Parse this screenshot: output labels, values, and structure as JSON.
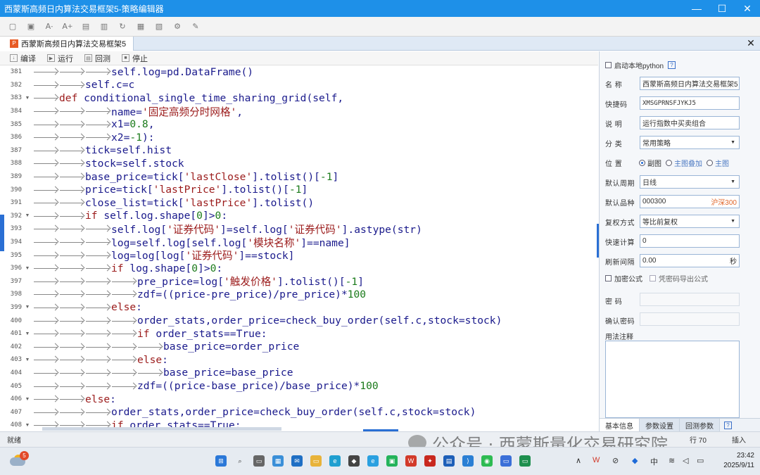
{
  "window": {
    "title": "西蒙斯高频日内算法交易框架5-策略编辑器",
    "controls": [
      "—",
      "☐",
      "✕"
    ]
  },
  "document_tab": {
    "label": "西蒙斯高频日内算法交易框架5",
    "close": "✕"
  },
  "editor_toolbar": [
    {
      "label": "编译",
      "icon": "compile-icon"
    },
    {
      "label": "运行",
      "icon": "run-icon"
    },
    {
      "label": "回测",
      "icon": "backtest-icon"
    },
    {
      "label": "停止",
      "icon": "stop-icon"
    }
  ],
  "code_lines": [
    {
      "n": "381",
      "fold": false,
      "indent": 3,
      "text": "self.log=pd.DataFrame()"
    },
    {
      "n": "382",
      "fold": false,
      "indent": 2,
      "text": "self.c=c"
    },
    {
      "n": "383",
      "fold": true,
      "indent": 1,
      "text": "def conditional_single_time_sharing_grid(self,"
    },
    {
      "n": "384",
      "fold": false,
      "indent": 3,
      "text": "name='固定高频分时网格',"
    },
    {
      "n": "385",
      "fold": false,
      "indent": 3,
      "text": "x1=0.8,"
    },
    {
      "n": "386",
      "fold": false,
      "indent": 3,
      "text": "x2=-1):"
    },
    {
      "n": "387",
      "fold": false,
      "indent": 2,
      "text": "tick=self.hist"
    },
    {
      "n": "388",
      "fold": false,
      "indent": 2,
      "text": "stock=self.stock"
    },
    {
      "n": "389",
      "fold": false,
      "indent": 2,
      "text": "base_price=tick['lastClose'].tolist()[-1]"
    },
    {
      "n": "390",
      "fold": false,
      "indent": 2,
      "text": "price=tick['lastPrice'].tolist()[-1]"
    },
    {
      "n": "391",
      "fold": false,
      "indent": 2,
      "text": "close_list=tick['lastPrice'].tolist()"
    },
    {
      "n": "392",
      "fold": true,
      "indent": 2,
      "text": "if self.log.shape[0]>0:"
    },
    {
      "n": "393",
      "fold": false,
      "indent": 3,
      "text": "self.log['证券代码']=self.log['证券代码'].astype(str)"
    },
    {
      "n": "394",
      "fold": false,
      "indent": 3,
      "text": "log=self.log[self.log['模块名称']==name]"
    },
    {
      "n": "395",
      "fold": false,
      "indent": 3,
      "text": "log=log[log['证券代码']==stock]"
    },
    {
      "n": "396",
      "fold": true,
      "indent": 3,
      "text": "if log.shape[0]>0:"
    },
    {
      "n": "397",
      "fold": false,
      "indent": 4,
      "text": "pre_price=log['触发价格'].tolist()[-1]"
    },
    {
      "n": "398",
      "fold": false,
      "indent": 4,
      "text": "zdf=((price-pre_price)/pre_price)*100"
    },
    {
      "n": "399",
      "fold": true,
      "indent": 3,
      "text": "else:"
    },
    {
      "n": "400",
      "fold": false,
      "indent": 4,
      "text": "order_stats,order_price=check_buy_order(self.c,stock=stock)"
    },
    {
      "n": "401",
      "fold": true,
      "indent": 4,
      "text": "if order_stats==True:"
    },
    {
      "n": "402",
      "fold": false,
      "indent": 5,
      "text": "base_price=order_price"
    },
    {
      "n": "403",
      "fold": true,
      "indent": 4,
      "text": "else:"
    },
    {
      "n": "404",
      "fold": false,
      "indent": 5,
      "text": "base_price=base_price"
    },
    {
      "n": "405",
      "fold": false,
      "indent": 4,
      "text": "zdf=((price-base_price)/base_price)*100"
    },
    {
      "n": "406",
      "fold": true,
      "indent": 2,
      "text": "else:"
    },
    {
      "n": "407",
      "fold": false,
      "indent": 3,
      "text": "order_stats,order_price=check_buy_order(self.c,stock=stock)"
    },
    {
      "n": "408",
      "fold": true,
      "indent": 3,
      "text": "if order_stats==True:"
    }
  ],
  "panel": {
    "local_python_label": "启动本地python",
    "help": "?",
    "name_label": "名 称",
    "name_value": "西蒙斯高频日内算法交易框架5",
    "shortcode_label": "快捷码",
    "shortcode_value": "XMSGPRNSFJYKJ5",
    "desc_label": "说 明",
    "desc_value": "运行指数中买卖组合",
    "category_label": "分 类",
    "category_value": "常用策略",
    "position_label": "位 置",
    "position_options": [
      "副图",
      "主图叠加",
      "主图"
    ],
    "period_label": "默认周期",
    "period_value": "日线",
    "variety_label": "默认品种",
    "variety_value": "000300",
    "variety_market": "沪深300",
    "adjust_label": "复权方式",
    "adjust_value": "等比前复权",
    "quickcalc_label": "快速计算",
    "quickcalc_value": "0",
    "refresh_label": "刷新间隔",
    "refresh_value": "0.00",
    "refresh_unit": "秒",
    "encrypt_label": "加密公式",
    "export_label": "凭密码导出公式",
    "password_label": "密 码",
    "confirm_label": "确认密码",
    "notes_label": "用法注释",
    "tabs": [
      "基本信息",
      "参数设置",
      "回测参数"
    ],
    "tab_help": "?"
  },
  "status": {
    "left": "就绪",
    "mid": "行 70",
    "right": "插入"
  },
  "watermark": "公众号 · 西蒙斯量化交易研究院",
  "taskbar": {
    "weather_badge": "5",
    "tray_lang": "中",
    "time": "23:42",
    "date": "2025/9/11"
  }
}
